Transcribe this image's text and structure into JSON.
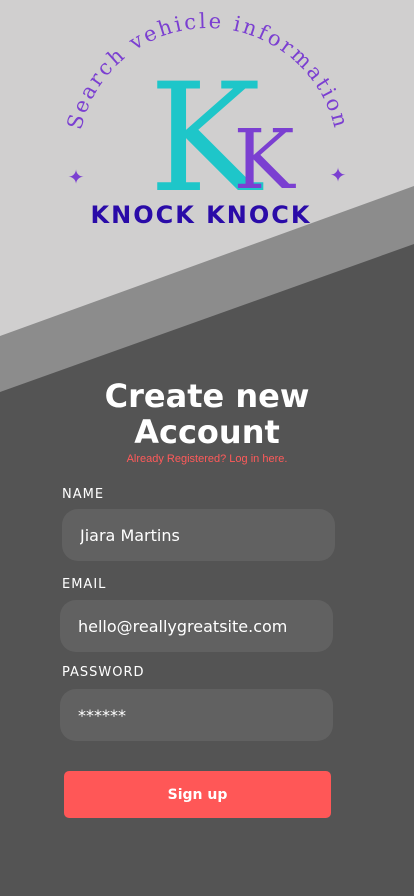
{
  "logo": {
    "arc_text": "Search vehicle information",
    "brand_name": "KNOCK KNOCK",
    "monogram_big": "K",
    "monogram_small": "K",
    "sparkle_glyph": "✦",
    "colors": {
      "teal": "#1ec6c9",
      "purple": "#7b3fd1",
      "brand": "#2a0ba8"
    }
  },
  "form": {
    "title_line1": "Create new",
    "title_line2": "Account",
    "login_link": "Already Registered? Log in here.",
    "name_label": "NAME",
    "name_value": "Jiara Martins",
    "email_label": "EMAIL",
    "email_value": "hello@reallygreatsite.com",
    "password_label": "PASSWORD",
    "password_value": "******",
    "signup_label": "Sign up"
  },
  "colors": {
    "bg_light": "#d0cfcf",
    "bg_mid": "#8c8c8c",
    "bg_dark": "#545454",
    "input_bg": "#616161",
    "accent": "#ff5757"
  }
}
